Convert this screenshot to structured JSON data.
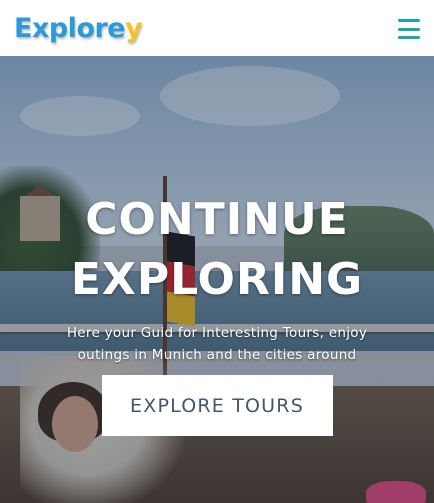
{
  "header": {
    "logo_main": "Explore",
    "logo_accent": "y",
    "menu_icon": "hamburger-menu-icon"
  },
  "hero": {
    "title_line1": "CONTINUE",
    "title_line2": "EXPLORING",
    "subtitle": "Here your Guid for Interesting Tours, enjoy outings in Munich and the cities around",
    "cta_label": "EXPLORE TOURS"
  },
  "colors": {
    "logo_blue": "#2b9ad6",
    "logo_yellow": "#f2c12e",
    "menu_teal": "#1aa7a7",
    "cta_text": "#45556b"
  }
}
